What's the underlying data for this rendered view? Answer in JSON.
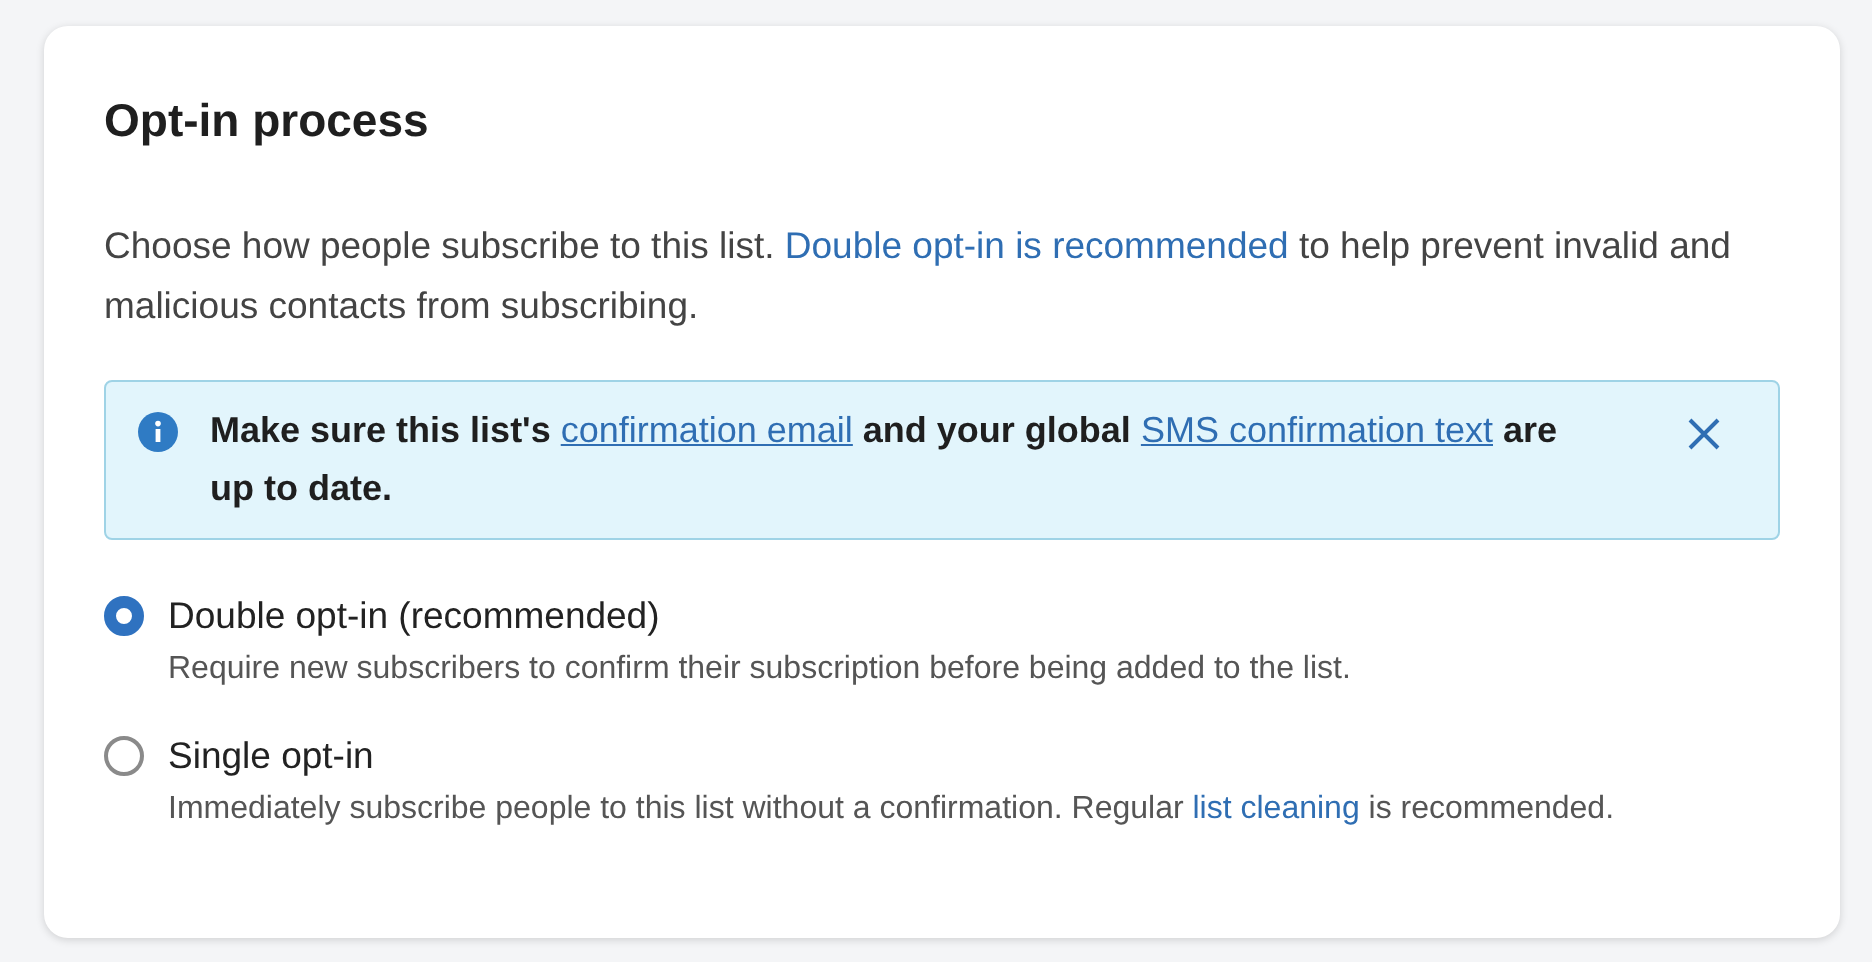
{
  "card": {
    "title": "Opt-in process",
    "intro": [
      {
        "text": "Choose how people subscribe to this list. ",
        "link": false
      },
      {
        "text": "Double opt-in is recommended",
        "link": true
      },
      {
        "text": " to help prevent invalid and malicious contacts from subscribing.",
        "link": false
      }
    ],
    "alert": {
      "message": [
        {
          "text": "Make sure this list's ",
          "link": false
        },
        {
          "text": "confirmation email",
          "link": true
        },
        {
          "text": " and your global ",
          "link": false
        },
        {
          "text": "SMS confirmation text",
          "link": true
        },
        {
          "text": " are up to date.",
          "link": false
        }
      ]
    },
    "options": [
      {
        "label": "Double opt-in (recommended)",
        "selected": true,
        "description": [
          {
            "text": "Require new subscribers to confirm their subscription before being added to the list.",
            "link": false
          }
        ]
      },
      {
        "label": "Single opt-in",
        "selected": false,
        "description": [
          {
            "text": "Immediately subscribe people to this list without a confirmation. Regular ",
            "link": false
          },
          {
            "text": "list cleaning",
            "link": true
          },
          {
            "text": " is recommended.",
            "link": false
          }
        ]
      }
    ]
  }
}
